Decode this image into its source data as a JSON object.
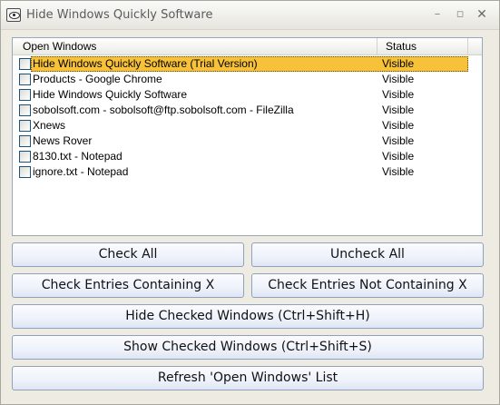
{
  "window": {
    "title": "Hide Windows Quickly Software",
    "minimize_glyph": "–",
    "maximize_glyph": "▫",
    "close_glyph": "✕"
  },
  "list": {
    "columns": {
      "name": "Open Windows",
      "status": "Status"
    },
    "rows": [
      {
        "name": "Hide Windows Quickly Software (Trial Version)",
        "status": "Visible",
        "checked": false,
        "selected": true
      },
      {
        "name": "Products - Google Chrome",
        "status": "Visible",
        "checked": false,
        "selected": false
      },
      {
        "name": "Hide Windows Quickly Software",
        "status": "Visible",
        "checked": false,
        "selected": false
      },
      {
        "name": "sobolsoft.com - sobolsoft@ftp.sobolsoft.com - FileZilla",
        "status": "Visible",
        "checked": false,
        "selected": false
      },
      {
        "name": "Xnews",
        "status": "Visible",
        "checked": false,
        "selected": false
      },
      {
        "name": "News Rover",
        "status": "Visible",
        "checked": false,
        "selected": false
      },
      {
        "name": "8130.txt - Notepad",
        "status": "Visible",
        "checked": false,
        "selected": false
      },
      {
        "name": "ignore.txt - Notepad",
        "status": "Visible",
        "checked": false,
        "selected": false
      }
    ]
  },
  "buttons": {
    "check_all": "Check All",
    "uncheck_all": "Uncheck All",
    "check_containing": "Check Entries Containing X",
    "check_not_containing": "Check Entries Not Containing X",
    "hide_checked": "Hide Checked Windows (Ctrl+Shift+H)",
    "show_checked": "Show Checked Windows (Ctrl+Shift+S)",
    "refresh": "Refresh 'Open Windows' List"
  },
  "colors": {
    "selection": "#f7c239",
    "window_bg": "#eeece2",
    "button_border": "#8fa1bd"
  }
}
